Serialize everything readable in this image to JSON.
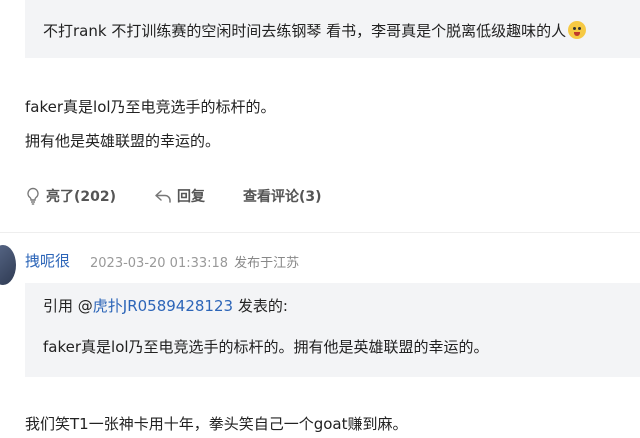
{
  "top_quote": {
    "text": "不打rank 不打训练赛的空闲时间去练钢琴 看书，李哥真是个脱离低级趣味的人"
  },
  "post": {
    "lines": [
      "faker真是lol乃至电竞选手的标杆的。",
      "拥有他是英雄联盟的幸运的。"
    ],
    "actions": {
      "like": "亮了(202)",
      "reply": "回复",
      "comments": "查看评论(3)"
    }
  },
  "reply": {
    "username": "拽呢很",
    "timestamp": "2023-03-20 01:33:18",
    "location": "发布于江苏",
    "quote": {
      "prefix": "引用 @",
      "author": "虎扑JR0589428123",
      "suffix": " 发表的:",
      "text": "faker真是lol乃至电竞选手的标杆的。拥有他是英雄联盟的幸运的。"
    },
    "body": "我们笑T1一张神卡用十年，拳头笑自己一个goat赚到麻。"
  },
  "colors": {
    "link_blue": "#2c65b8",
    "quote_bg": "#f3f4f6",
    "meta_gray": "#999999"
  },
  "icons": [
    "emoji-icon",
    "lightbulb-icon",
    "reply-arrow-icon"
  ]
}
